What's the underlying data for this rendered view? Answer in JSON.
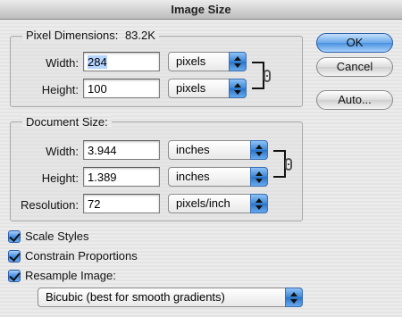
{
  "window": {
    "title": "Image Size"
  },
  "pixel_dimensions": {
    "title": "Pixel Dimensions:",
    "size": "83.2K",
    "width_label": "Width:",
    "width_value": "284",
    "width_unit": "pixels",
    "height_label": "Height:",
    "height_value": "100",
    "height_unit": "pixels"
  },
  "document_size": {
    "title": "Document Size:",
    "width_label": "Width:",
    "width_value": "3.944",
    "width_unit": "inches",
    "height_label": "Height:",
    "height_value": "1.389",
    "height_unit": "inches",
    "resolution_label": "Resolution:",
    "resolution_value": "72",
    "resolution_unit": "pixels/inch"
  },
  "buttons": {
    "ok": "OK",
    "cancel": "Cancel",
    "auto": "Auto..."
  },
  "options": {
    "scale_styles": "Scale Styles",
    "constrain_proportions": "Constrain Proportions",
    "resample_image": "Resample Image:",
    "resample_method": "Bicubic (best for smooth gradients)"
  },
  "icons": {
    "pixel_link": "chain-link-icon",
    "document_link": "chain-link-icon",
    "popup_arrows": "up-down-arrows-icon",
    "checkmark": "checkmark-icon"
  },
  "colors": {
    "accent_blue": "#3b86d6",
    "selection": "#b5d5ff"
  }
}
